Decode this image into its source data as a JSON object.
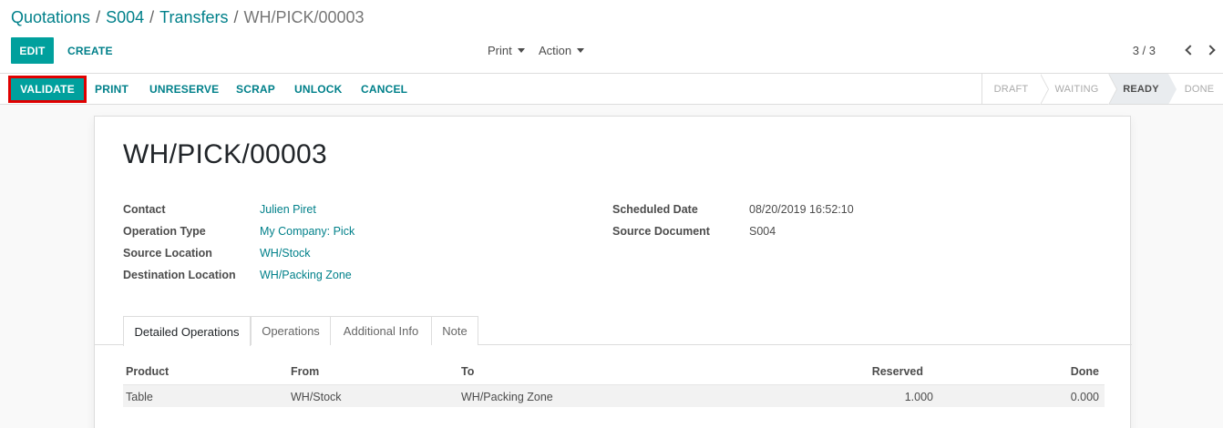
{
  "breadcrumb": {
    "items": [
      "Quotations",
      "S004",
      "Transfers"
    ],
    "current": "WH/PICK/00003",
    "separator": "/"
  },
  "control_panel": {
    "edit_label": "EDIT",
    "create_label": "CREATE",
    "print_label": "Print",
    "action_label": "Action",
    "pager": "3 / 3"
  },
  "statusbar": {
    "buttons": [
      "VALIDATE",
      "PRINT",
      "UNRESERVE",
      "SCRAP",
      "UNLOCK",
      "CANCEL"
    ],
    "stages": [
      "DRAFT",
      "WAITING",
      "READY",
      "DONE"
    ],
    "active_stage": "READY"
  },
  "form": {
    "title": "WH/PICK/00003",
    "left_fields": [
      {
        "label": "Contact",
        "value": "Julien Piret"
      },
      {
        "label": "Operation Type",
        "value": "My Company: Pick"
      },
      {
        "label": "Source Location",
        "value": "WH/Stock"
      },
      {
        "label": "Destination Location",
        "value": "WH/Packing Zone"
      }
    ],
    "right_fields": [
      {
        "label": "Scheduled Date",
        "value": "08/20/2019 16:52:10"
      },
      {
        "label": "Source Document",
        "value": "S004"
      }
    ],
    "tabs": [
      "Detailed Operations",
      "Operations",
      "Additional Info",
      "Note"
    ],
    "table": {
      "headers": [
        "Product",
        "From",
        "To",
        "Reserved",
        "Done"
      ],
      "rows": [
        [
          "Table",
          "WH/Stock",
          "WH/Packing Zone",
          "1.000",
          "0.000"
        ]
      ]
    }
  },
  "colors": {
    "primary": "#00a09d",
    "link": "#00808a",
    "highlight_border": "#e00000"
  }
}
